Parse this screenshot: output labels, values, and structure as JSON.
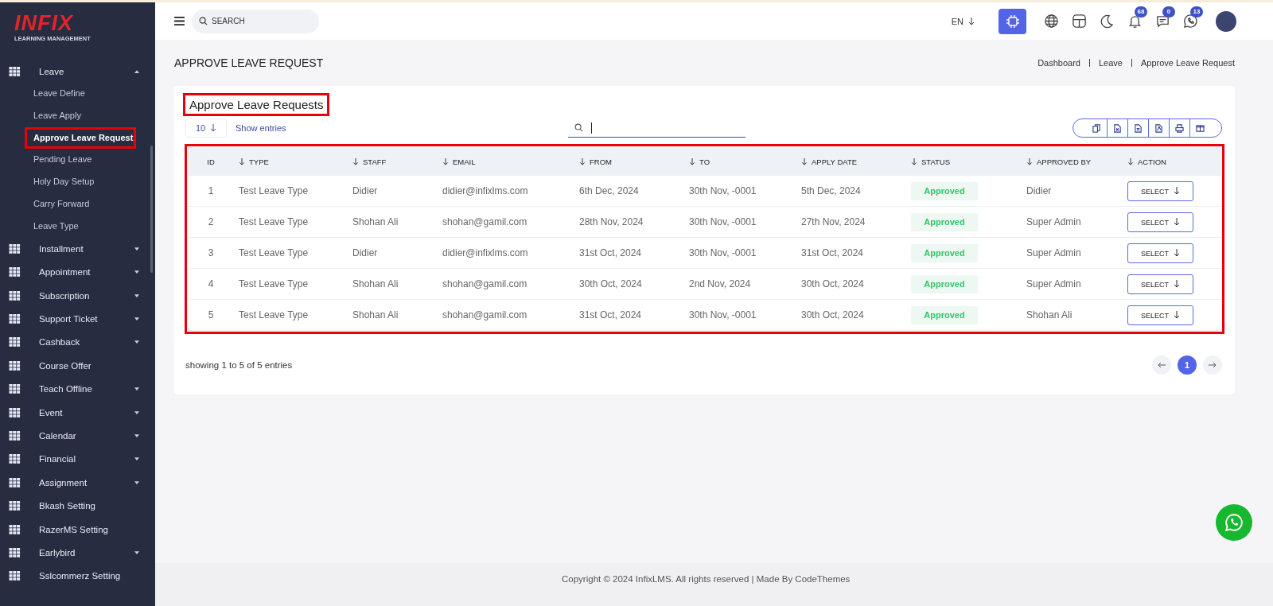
{
  "logo": {
    "mark": "INFIX",
    "tagline": "LEARNING MANAGEMENT"
  },
  "sidebar": {
    "items": [
      {
        "label": "Leave",
        "expanded": true,
        "children": [
          {
            "label": "Leave Define",
            "selected": false,
            "highlighted": false
          },
          {
            "label": "Leave Apply",
            "selected": false,
            "highlighted": false
          },
          {
            "label": "Approve Leave Request",
            "selected": true,
            "highlighted": true
          },
          {
            "label": "Pending Leave",
            "selected": false,
            "highlighted": false
          },
          {
            "label": "Holy Day Setup",
            "selected": false,
            "highlighted": false
          },
          {
            "label": "Carry Forward",
            "selected": false,
            "highlighted": false
          },
          {
            "label": "Leave Type",
            "selected": false,
            "highlighted": false
          }
        ]
      },
      {
        "label": "Installment",
        "expanded": false
      },
      {
        "label": "Appointment",
        "expanded": false
      },
      {
        "label": "Subscription",
        "expanded": false
      },
      {
        "label": "Support Ticket",
        "expanded": false
      },
      {
        "label": "Cashback",
        "expanded": false
      },
      {
        "label": "Course Offer"
      },
      {
        "label": "Teach Offline",
        "expanded": false
      },
      {
        "label": "Event",
        "expanded": false
      },
      {
        "label": "Calendar",
        "expanded": false
      },
      {
        "label": "Financial",
        "expanded": false
      },
      {
        "label": "Assignment",
        "expanded": false
      },
      {
        "label": "Bkash Setting"
      },
      {
        "label": "RazerMS Setting"
      },
      {
        "label": "Earlybird",
        "expanded": false
      },
      {
        "label": "Sslcommerz Setting"
      }
    ]
  },
  "topbar": {
    "search": {
      "placeholder": "SEARCH"
    },
    "language": "EN",
    "badges": [
      {
        "kind": "bell",
        "count": "68"
      },
      {
        "kind": "chat",
        "count": "0"
      },
      {
        "kind": "phone",
        "count": "13"
      }
    ]
  },
  "page": {
    "title": "APPROVE LEAVE REQUEST",
    "breadcrumb": [
      "Dashboard",
      "Leave",
      "Approve Leave Request"
    ]
  },
  "card": {
    "title": "Approve Leave Requests",
    "title_highlighted": true,
    "page_size": "10",
    "show_entries": "Show entries",
    "export_buttons": [
      {
        "kind": "copy"
      },
      {
        "kind": "excel"
      },
      {
        "kind": "csv"
      },
      {
        "kind": "pdf"
      },
      {
        "kind": "print"
      },
      {
        "kind": "columns"
      }
    ],
    "table": {
      "highlighted": true,
      "columns": [
        {
          "label": "ID",
          "sortable": false
        },
        {
          "label": "TYPE",
          "sortable": true
        },
        {
          "label": "STAFF",
          "sortable": true
        },
        {
          "label": "EMAIL",
          "sortable": true
        },
        {
          "label": "FROM",
          "sortable": true
        },
        {
          "label": "TO",
          "sortable": true
        },
        {
          "label": "APPLY DATE",
          "sortable": true
        },
        {
          "label": "STATUS",
          "sortable": true
        },
        {
          "label": "APPROVED BY",
          "sortable": true
        },
        {
          "label": "ACTION",
          "sortable": true
        }
      ],
      "rows": [
        {
          "id": "1",
          "type": "Test Leave Type",
          "staff": "Didier",
          "email": "didier@infixlms.com",
          "from": "6th Dec, 2024",
          "to": "30th Nov, -0001",
          "apply_date": "5th Dec, 2024",
          "status": "Approved",
          "approved_by": "Didier",
          "action": "SELECT"
        },
        {
          "id": "2",
          "type": "Test Leave Type",
          "staff": "Shohan Ali",
          "email": "shohan@gamil.com",
          "from": "28th Nov, 2024",
          "to": "30th Nov, -0001",
          "apply_date": "27th Nov, 2024",
          "status": "Approved",
          "approved_by": "Super Admin",
          "action": "SELECT"
        },
        {
          "id": "3",
          "type": "Test Leave Type",
          "staff": "Didier",
          "email": "didier@infixlms.com",
          "from": "31st Oct, 2024",
          "to": "30th Nov, -0001",
          "apply_date": "31st Oct, 2024",
          "status": "Approved",
          "approved_by": "Super Admin",
          "action": "SELECT"
        },
        {
          "id": "4",
          "type": "Test Leave Type",
          "staff": "Shohan Ali",
          "email": "shohan@gamil.com",
          "from": "30th Oct, 2024",
          "to": "2nd Nov, 2024",
          "apply_date": "30th Oct, 2024",
          "status": "Approved",
          "approved_by": "Super Admin",
          "action": "SELECT"
        },
        {
          "id": "5",
          "type": "Test Leave Type",
          "staff": "Shohan Ali",
          "email": "shohan@gamil.com",
          "from": "31st Oct, 2024",
          "to": "30th Nov, -0001",
          "apply_date": "30th Oct, 2024",
          "status": "Approved",
          "approved_by": "Shohan Ali",
          "action": "SELECT"
        }
      ]
    },
    "summary": "showing 1 to 5 of 5 entries",
    "pages": [
      {
        "label": "1",
        "selected": true
      }
    ]
  },
  "footer": "Copyright © 2024 InfixLMS. All rights reserved | Made By CodeThemes"
}
